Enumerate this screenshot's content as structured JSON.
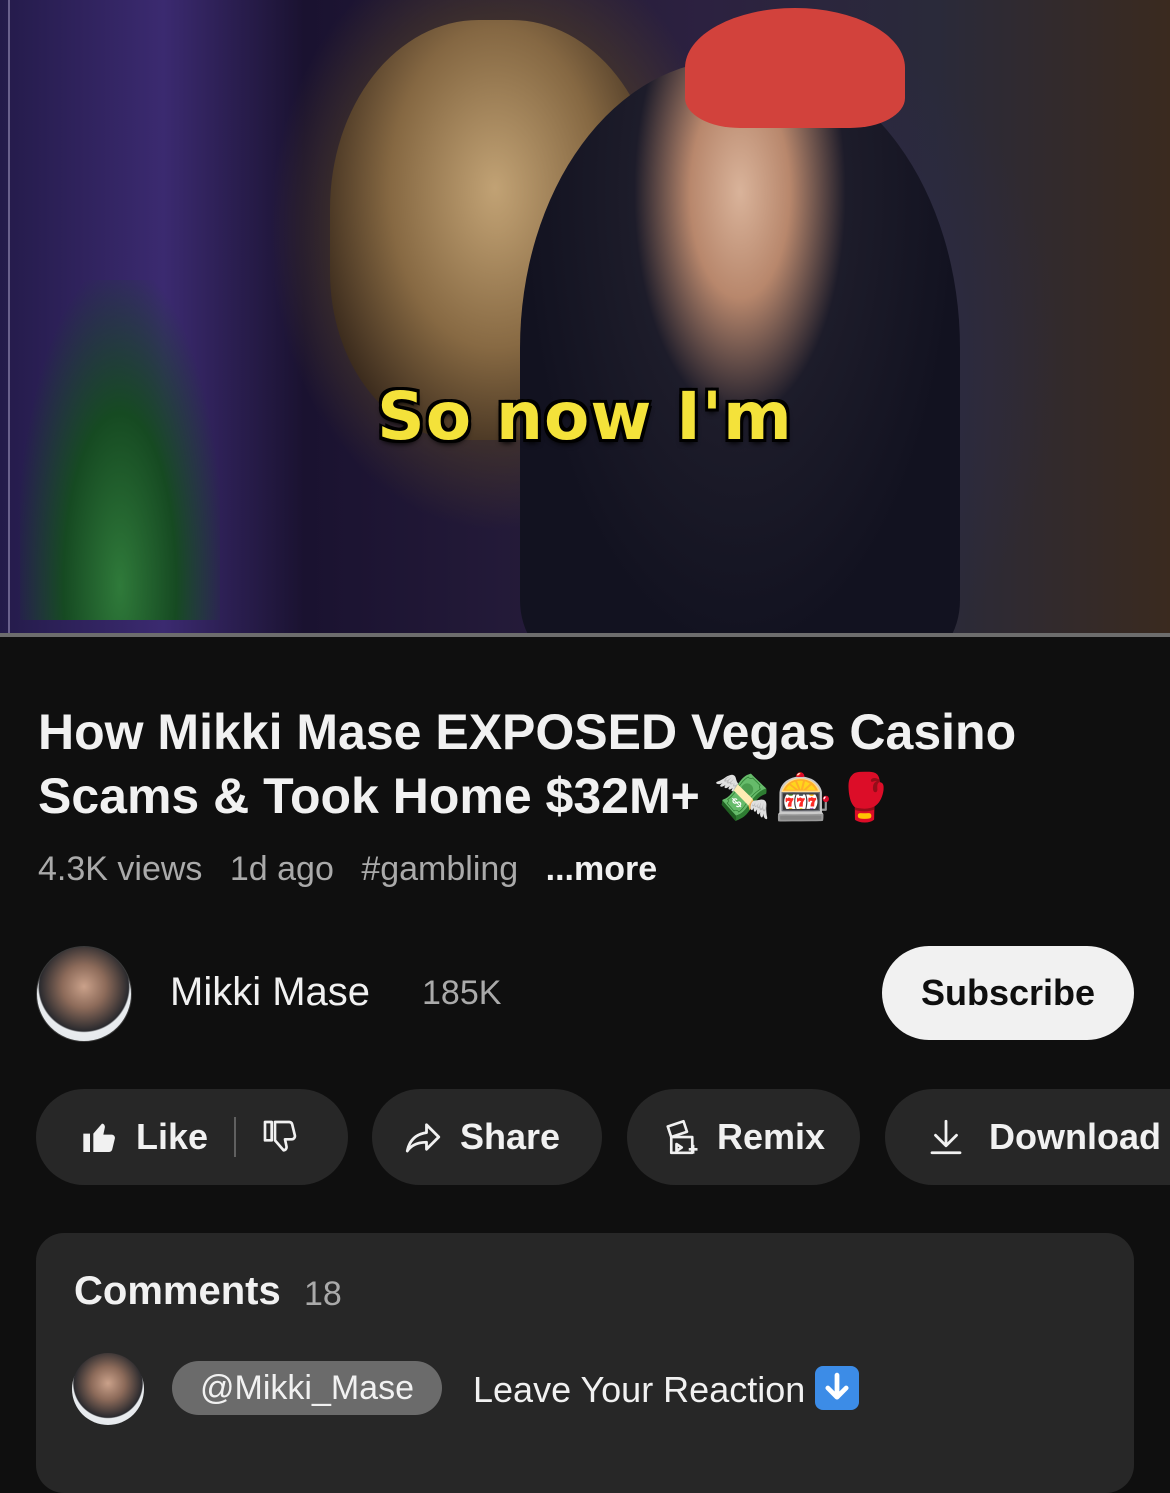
{
  "player": {
    "caption": "So now I'm"
  },
  "video": {
    "title": "How Mikki Mase EXPOSED Vegas Casino Scams & Took Home $32M+",
    "title_emoji": "💸🎰🥊",
    "views": "4.3K views",
    "age": "1d ago",
    "hashtag": "#gambling",
    "more_label": "...more"
  },
  "channel": {
    "name": "Mikki Mase",
    "subscribers": "185K",
    "subscribe_label": "Subscribe"
  },
  "actions": {
    "like_label": "Like",
    "share_label": "Share",
    "remix_label": "Remix",
    "download_label": "Download"
  },
  "comments": {
    "title": "Comments",
    "count": "18",
    "top_comment": {
      "mention": "@Mikki_Mase",
      "text": "Leave Your Reaction"
    }
  },
  "colors": {
    "background": "#0f0f0f",
    "pill": "#272727",
    "caption": "#f4e23a",
    "secondary_text": "#aaaaaa"
  }
}
